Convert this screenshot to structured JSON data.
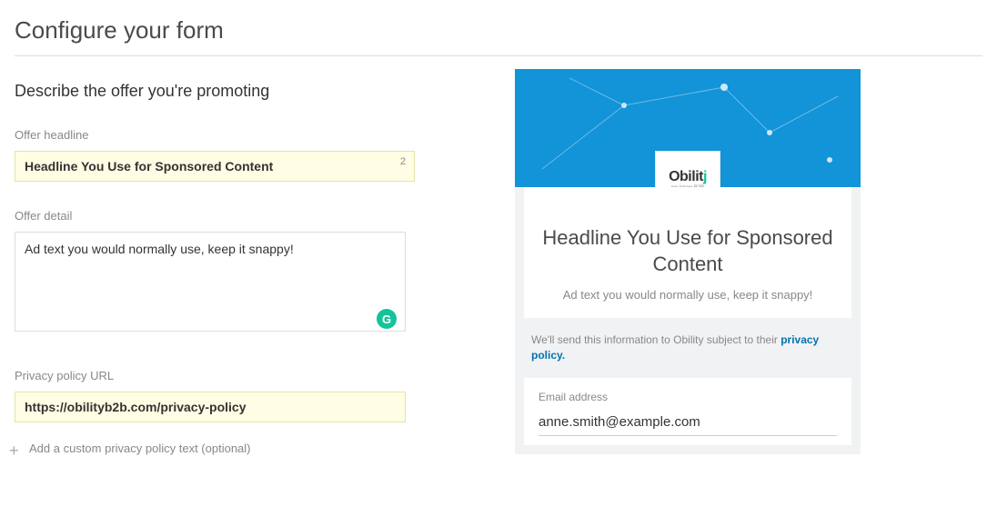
{
  "page": {
    "title": "Configure your form"
  },
  "section": {
    "title": "Describe the offer you're promoting"
  },
  "offer_headline": {
    "label": "Offer headline",
    "value": "Headline You Use for Sponsored Content",
    "counter": "2"
  },
  "offer_detail": {
    "label": "Offer detail",
    "value": "Ad text you would normally use, keep it snappy!"
  },
  "privacy_url": {
    "label": "Privacy policy URL",
    "value": "https://obilityb2b.com/privacy-policy"
  },
  "optional": {
    "label": "Add a custom privacy policy text (optional)"
  },
  "preview": {
    "logo_name": "Obilit",
    "headline": "Headline You Use for Sponsored Content",
    "subtext": "Ad text you would normally use, keep it snappy!",
    "disclaimer_prefix": "We'll send this information to Obility subject to their ",
    "disclaimer_link": "privacy policy.",
    "email_label": "Email address",
    "email_value": "anne.smith@example.com"
  }
}
